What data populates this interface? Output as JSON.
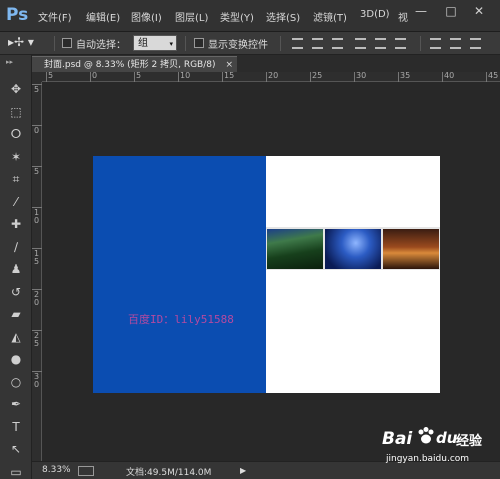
{
  "app": {
    "logo": "Ps"
  },
  "menu": [
    "文件(F)",
    "编辑(E)",
    "图像(I)",
    "图层(L)",
    "类型(Y)",
    "选择(S)",
    "滤镜(T)",
    "3D(D)",
    "视"
  ],
  "window_controls": {
    "minimize": "—",
    "restore": "□",
    "close": "✕"
  },
  "options": {
    "auto_select_label": "自动选择：",
    "auto_select_value": "组",
    "show_transform_label": "显示变换控件"
  },
  "document_tab": {
    "title": "封面.psd @ 8.33% (矩形 2 拷贝, RGB/8)",
    "close": "×"
  },
  "ruler_h_labels": [
    "5",
    "0",
    "5",
    "10",
    "15",
    "20",
    "25",
    "30",
    "35",
    "40",
    "45"
  ],
  "ruler_v_labels": [
    "5",
    "0",
    "5",
    "1\n0",
    "1\n5",
    "2\n0",
    "2\n5",
    "3\n0"
  ],
  "tools": [
    {
      "name": "move-tool-icon",
      "glyph": "✥"
    },
    {
      "name": "marquee-tool-icon",
      "glyph": "⬚"
    },
    {
      "name": "lasso-tool-icon",
      "glyph": "ⵔ"
    },
    {
      "name": "magic-wand-tool-icon",
      "glyph": "✶"
    },
    {
      "name": "crop-tool-icon",
      "glyph": "⌗"
    },
    {
      "name": "eyedropper-tool-icon",
      "glyph": "⁄"
    },
    {
      "name": "healing-brush-tool-icon",
      "glyph": "✚"
    },
    {
      "name": "brush-tool-icon",
      "glyph": "∕"
    },
    {
      "name": "clone-stamp-tool-icon",
      "glyph": "♟"
    },
    {
      "name": "history-brush-tool-icon",
      "glyph": "↺"
    },
    {
      "name": "eraser-tool-icon",
      "glyph": "▰"
    },
    {
      "name": "paint-bucket-tool-icon",
      "glyph": "◭"
    },
    {
      "name": "blur-tool-icon",
      "glyph": "●"
    },
    {
      "name": "dodge-tool-icon",
      "glyph": "○"
    },
    {
      "name": "pen-tool-icon",
      "glyph": "✒"
    },
    {
      "name": "type-tool-icon",
      "glyph": "T"
    },
    {
      "name": "path-selection-tool-icon",
      "glyph": "↖"
    },
    {
      "name": "rectangle-tool-icon",
      "glyph": "▭"
    }
  ],
  "canvas": {
    "blue_color": "#0b4db1",
    "text": "百度ID：lily51588"
  },
  "status": {
    "zoom": "8.33%",
    "doc_info": "文档:49.5M/114.0M",
    "arrow": "▶"
  },
  "watermark": {
    "brand": "Bai",
    "brand2": "du",
    "jingyan": "经验",
    "url": "jingyan.baidu.com"
  }
}
